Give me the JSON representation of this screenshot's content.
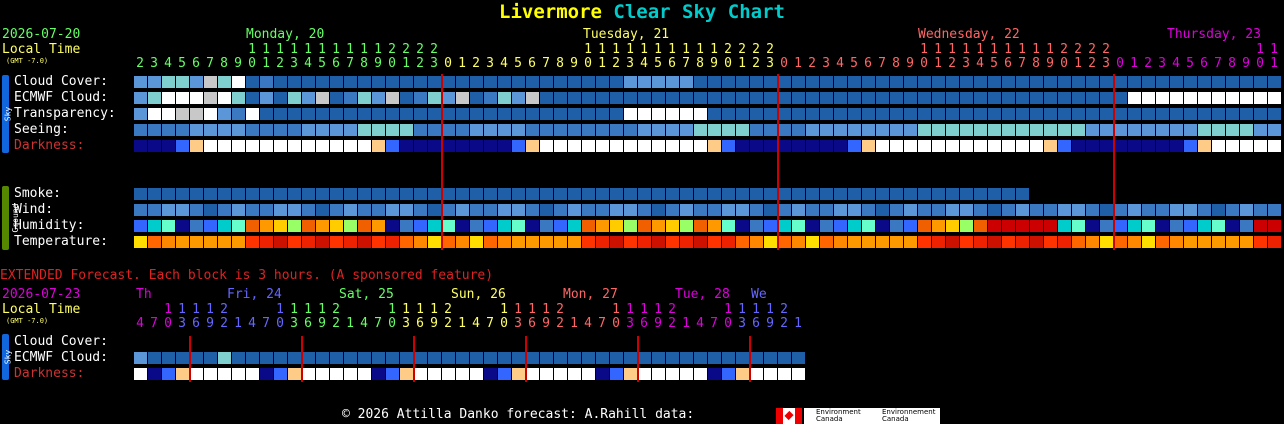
{
  "title": {
    "city": "Livermore",
    "suffix": "Clear Sky Chart",
    "city_color": "#ffff00",
    "suffix_color": "#00cccc"
  },
  "header": {
    "date": "2026-07-20",
    "local_time": "Local Time",
    "gmt": "(GMT -7.0)",
    "days": [
      {
        "label": "Monday, 20",
        "color": "#66ff66"
      },
      {
        "label": "Tuesday, 21",
        "color": "#ffff66"
      },
      {
        "label": "Wednesday, 22",
        "color": "#ff6666"
      },
      {
        "label": "Thursday, 23",
        "color": "#dd00dd"
      }
    ]
  },
  "sections": {
    "sky": "Sky",
    "ground": "Ground"
  },
  "rows": {
    "cloud": "Cloud Cover:",
    "ecmwf": "ECMWF Cloud:",
    "transparency": "Transparency:",
    "seeing": "Seeing:",
    "darkness": "Darkness:",
    "smoke": "Smoke:",
    "wind": "Wind:",
    "humidity": "Humidity:",
    "temperature": "Temperature:"
  },
  "extended": {
    "note": "EXTENDED Forecast. Each block is 3 hours. (A sponsored feature)",
    "date": "2026-07-23",
    "local_time": "Local Time",
    "gmt": "(GMT -7.0)",
    "days": [
      {
        "label": "Th",
        "color": "#dd00dd"
      },
      {
        "label": "Fri, 24",
        "color": "#6666ff"
      },
      {
        "label": "Sat, 25",
        "color": "#66ff66"
      },
      {
        "label": "Sun, 26",
        "color": "#ffff66"
      },
      {
        "label": "Mon, 27",
        "color": "#ff6666"
      },
      {
        "label": "Tue, 28",
        "color": "#dd00dd"
      },
      {
        "label": "We",
        "color": "#6666ff"
      }
    ],
    "cloud": "Cloud Cover:",
    "ecmwf": "ECMWF Cloud:",
    "darkness": "Darkness:"
  },
  "footer": {
    "text": "© 2026 Attilla Danko  forecast: A.Rahill  data:",
    "logo_en": "Environment Canada",
    "logo_fr": "Environnement Canada"
  }
}
